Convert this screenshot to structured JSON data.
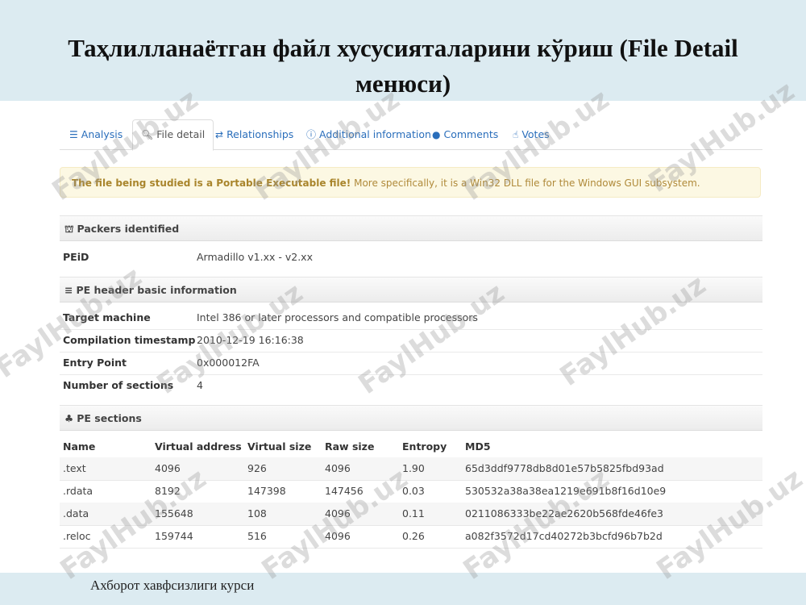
{
  "slide": {
    "title": "Таҳлилланаётган файл хусусияталарини кўриш (File Detail менюси)",
    "footer": "Ахборот хавфсизлиги курси"
  },
  "tabs": [
    {
      "label": "Analysis",
      "icon": "list-icon"
    },
    {
      "label": "File detail",
      "icon": "search-icon",
      "active": true
    },
    {
      "label": "Relationships",
      "icon": "shuffle-icon"
    },
    {
      "label": "Additional information",
      "icon": "info-icon"
    },
    {
      "label": "Comments",
      "icon": "comment-icon"
    },
    {
      "label": "Votes",
      "icon": "thumbs-icon"
    }
  ],
  "alert": {
    "bold": "The file being studied is a Portable Executable file!",
    "rest": " More specifically, it is a Win32 DLL file for the Windows GUI subsystem."
  },
  "packers": {
    "heading": "Packers identified",
    "key": "PEiD",
    "value": "Armadillo v1.xx - v2.xx"
  },
  "pe_header": {
    "heading": "PE header basic information",
    "rows": [
      {
        "key": "Target machine",
        "value": "Intel 386 or later processors and compatible processors"
      },
      {
        "key": "Compilation timestamp",
        "value": "2010-12-19 16:16:38"
      },
      {
        "key": "Entry Point",
        "value": "0x000012FA"
      },
      {
        "key": "Number of sections",
        "value": "4"
      }
    ]
  },
  "pe_sections": {
    "heading": "PE sections",
    "columns": [
      "Name",
      "Virtual address",
      "Virtual size",
      "Raw size",
      "Entropy",
      "MD5"
    ],
    "rows": [
      [
        ".text",
        "4096",
        "926",
        "4096",
        "1.90",
        "65d3ddf9778db8d01e57b5825fbd93ad"
      ],
      [
        ".rdata",
        "8192",
        "147398",
        "147456",
        "0.03",
        "530532a38a38ea1219e691b8f16d10e9"
      ],
      [
        ".data",
        "155648",
        "108",
        "4096",
        "0.11",
        "0211086333be22ae2620b568fde46fe3"
      ],
      [
        ".reloc",
        "159744",
        "516",
        "4096",
        "0.26",
        "a082f3572d17cd40272b3bcfd96b7b2d"
      ]
    ]
  },
  "watermark": "FaylHub.uz"
}
